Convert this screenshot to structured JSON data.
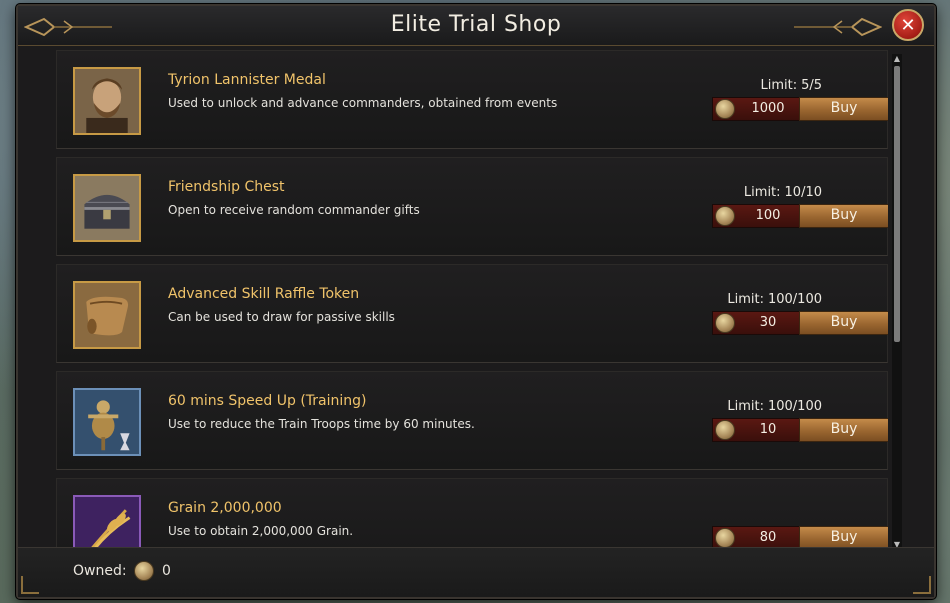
{
  "window": {
    "title": "Elite Trial Shop",
    "close_icon": "close-icon"
  },
  "limit_label": "Limit:",
  "buy_label": "Buy",
  "items": [
    {
      "name": "Tyrion Lannister Medal",
      "description": "Used to unlock and advance commanders, obtained from events",
      "limit": "5/5",
      "price": "1000",
      "icon": "commander-portrait-icon"
    },
    {
      "name": "Friendship Chest",
      "description": "Open to receive random commander gifts",
      "limit": "10/10",
      "price": "100",
      "icon": "chest-icon"
    },
    {
      "name": "Advanced Skill Raffle Token",
      "description": "Can be used to draw for passive skills",
      "limit": "100/100",
      "price": "30",
      "icon": "scroll-icon"
    },
    {
      "name": "60 mins Speed Up (Training)",
      "description": "Use to reduce the Train Troops time by 60 minutes.",
      "limit": "100/100",
      "price": "10",
      "icon": "training-dummy-icon"
    },
    {
      "name": "Grain 2,000,000",
      "description": "Use to obtain 2,000,000 Grain.",
      "limit": "",
      "price": "80",
      "icon": "grain-icon"
    }
  ],
  "footer": {
    "owned_label": "Owned:",
    "owned_value": "0",
    "currency_icon": "coin-icon"
  },
  "colors": {
    "item_name": "#f0c36a",
    "buy_button": "#9a6630",
    "price_box": "#5a1812",
    "close_button": "#c1271d"
  }
}
